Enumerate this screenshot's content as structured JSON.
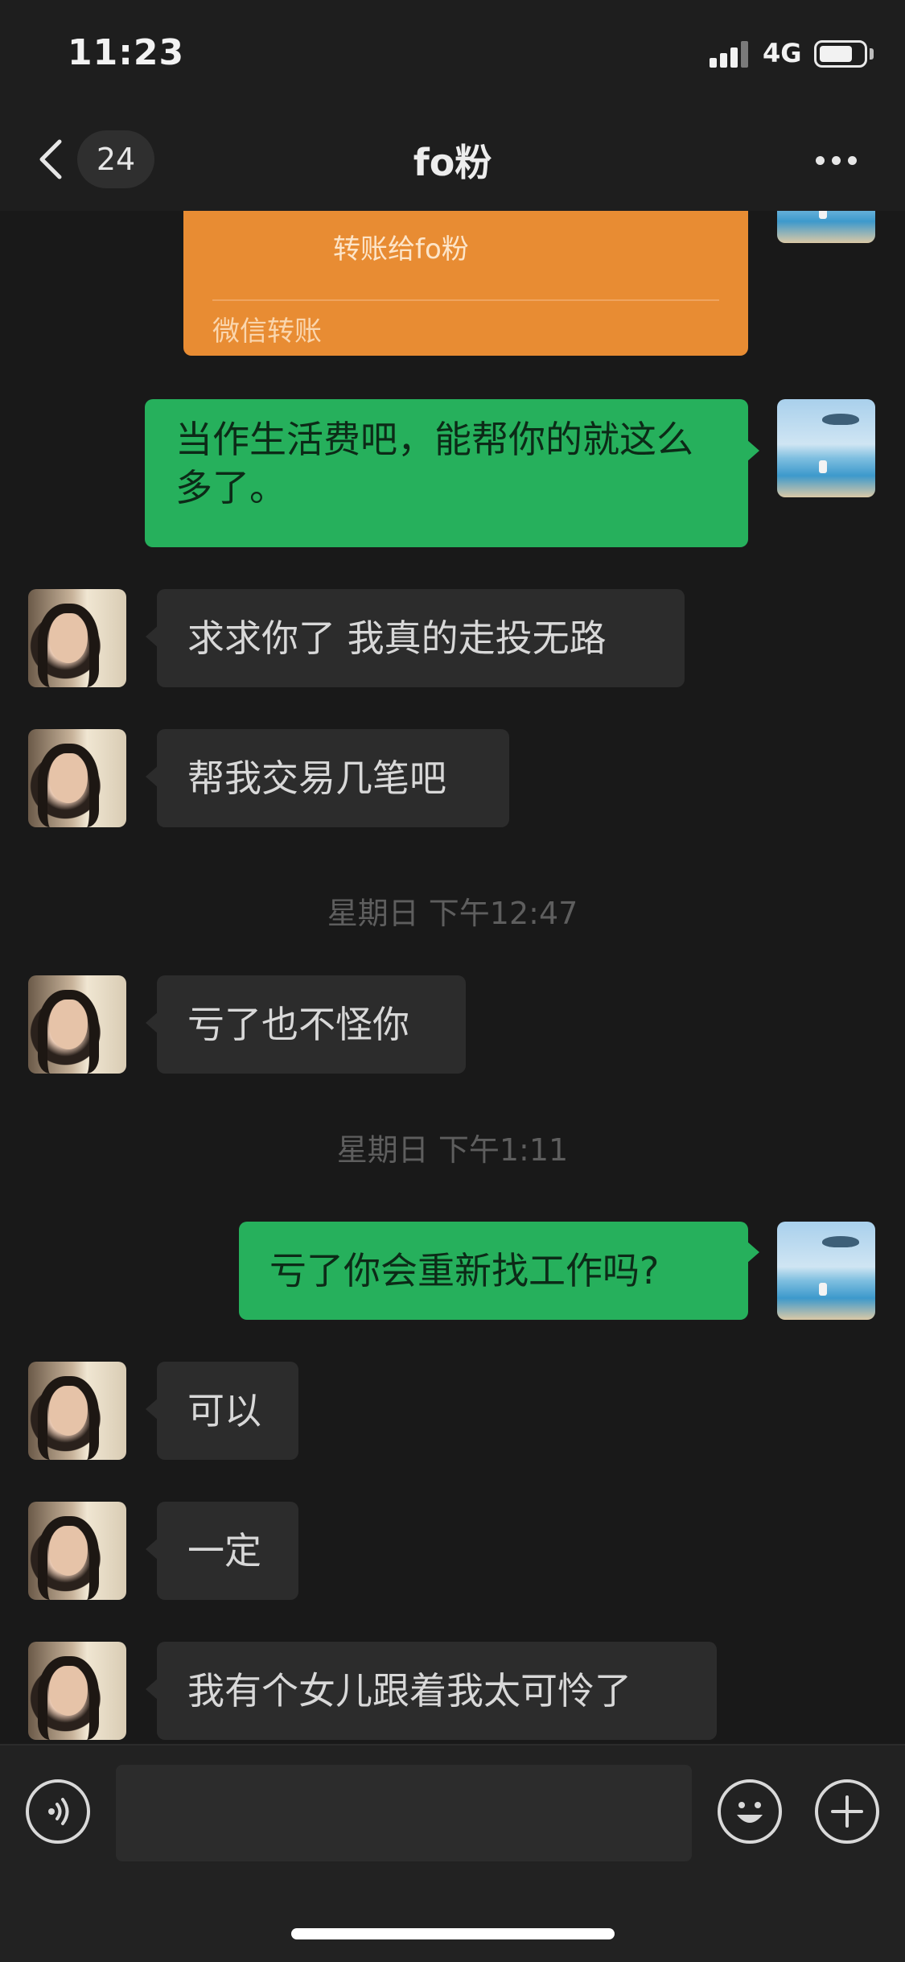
{
  "status_bar": {
    "time": "11:23",
    "network": "4G"
  },
  "nav": {
    "unread_count": "24",
    "title": "fo粉"
  },
  "transfer": {
    "description": "转账给fo粉",
    "label": "微信转账"
  },
  "messages": [
    {
      "from": "me",
      "text": "当作生活费吧，能帮你的就这么多了。"
    },
    {
      "from": "her",
      "text": "求求你了 我真的走投无路"
    },
    {
      "from": "her",
      "text": "帮我交易几笔吧"
    },
    {
      "type": "timestamp",
      "text": "星期日 下午12:47"
    },
    {
      "from": "her",
      "text": "亏了也不怪你"
    },
    {
      "type": "timestamp",
      "text": "星期日 下午1:11"
    },
    {
      "from": "me",
      "text": "亏了你会重新找工作吗?"
    },
    {
      "from": "her",
      "text": "可以"
    },
    {
      "from": "her",
      "text": "一定"
    },
    {
      "from": "her",
      "text": "我有个女儿跟着我太可怜了"
    }
  ],
  "input_bar": {
    "placeholder": "",
    "value": ""
  },
  "icons": {
    "back": "chevron-left-icon",
    "more": "ellipsis-icon",
    "transfer": "transfer-arrow-icon",
    "voice": "voice-icon",
    "emoji": "emoji-icon",
    "plus": "plus-icon"
  },
  "colors": {
    "background": "#191919",
    "my_bubble": "#26b05c",
    "her_bubble": "#2c2c2c",
    "transfer_card": "#e88c33"
  }
}
